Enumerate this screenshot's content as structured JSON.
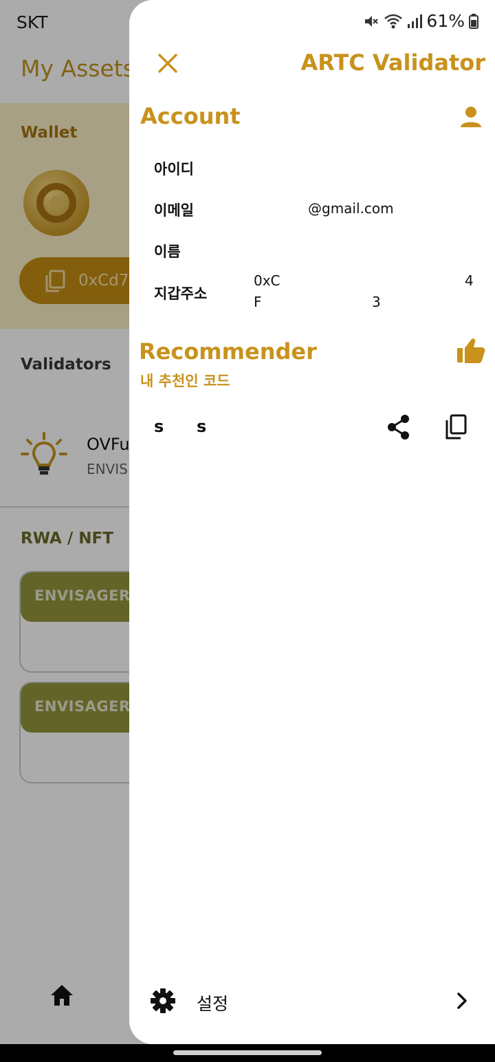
{
  "status_bar": {
    "carrier": "SKT",
    "battery": "61%"
  },
  "background": {
    "title": "My Assets",
    "wallet_label": "Wallet",
    "address_text": "0xCd7",
    "validators_label": "Validators",
    "validator_name": "OVFu",
    "validator_sub": "ENVIS",
    "rwa_label": "RWA / NFT",
    "nft_cards": [
      "ENVISAGER_",
      "ENVISAGER_"
    ]
  },
  "drawer": {
    "app_name": "ARTC Validator",
    "account": {
      "title": "Account",
      "rows": [
        {
          "label": "아이디",
          "value": ""
        },
        {
          "label": "이메일",
          "value": "@gmail.com"
        },
        {
          "label": "이름",
          "value": ""
        },
        {
          "label": "지갑주소",
          "value_line1_start": "0xC",
          "value_line1_end": "4",
          "value_line2_start": "F",
          "value_line2_mid": "3"
        }
      ]
    },
    "recommender": {
      "title": "Recommender",
      "subtitle": "내 추천인 코드",
      "code_chars": [
        "s",
        "s"
      ]
    },
    "settings_label": "설정"
  },
  "colors": {
    "accent": "#c8921c",
    "wallet_bg": "#fbefc6",
    "pill": "#c48d14",
    "nft_head": "#94963b"
  },
  "icons": [
    "close-icon",
    "person-icon",
    "thumbs-up-icon",
    "share-icon",
    "copy-icon",
    "gear-icon",
    "chevron-right-icon",
    "home-icon",
    "bulb-icon",
    "mute-icon",
    "wifi-icon",
    "signal-icon",
    "battery-icon"
  ]
}
